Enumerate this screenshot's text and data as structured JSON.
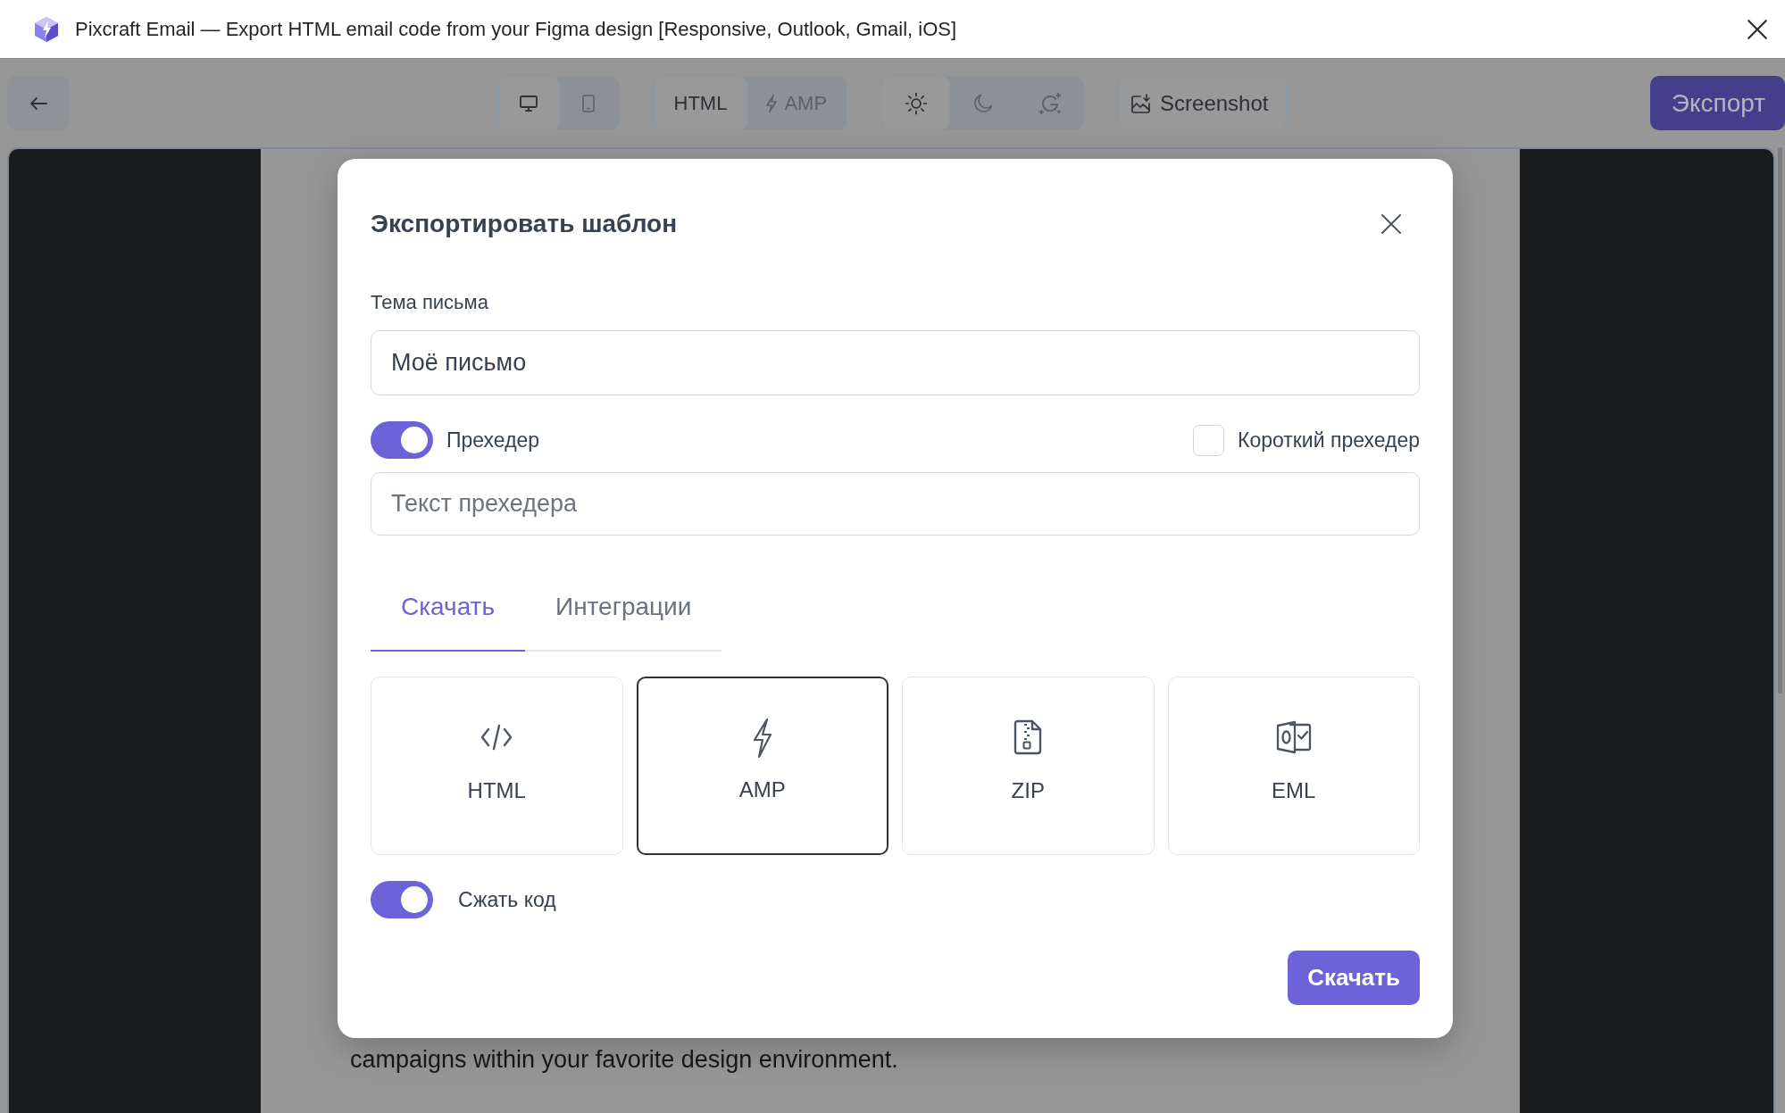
{
  "window": {
    "title": "Pixcraft Email — Export HTML email code from your Figma design [Responsive, Outlook, Gmail, iOS]"
  },
  "toolbar": {
    "device_toggle": [
      {
        "kind": "desktop",
        "selected": true
      },
      {
        "kind": "tablet",
        "selected": false
      }
    ],
    "format_toggle": [
      {
        "label": "HTML",
        "kind": "text",
        "selected": true
      },
      {
        "label": "AMP",
        "kind": "bolt",
        "selected": false
      }
    ],
    "theme_toggle": [
      {
        "kind": "light",
        "selected": true
      },
      {
        "kind": "dark",
        "selected": false
      },
      {
        "kind": "auto",
        "selected": false
      }
    ],
    "screenshot_button": {
      "label": "Screenshot"
    },
    "export_button": {
      "label": "Экспорт"
    }
  },
  "preview": {
    "text": "campaigns within your favorite design environment."
  },
  "dialog": {
    "title": "Экспортировать шаблон",
    "subject": {
      "label": "Тема письма",
      "value": "Моё письмо"
    },
    "preheader": {
      "label": "Прехедер",
      "on": true
    },
    "short_preheader": {
      "label": "Короткий прехедер",
      "checked": false
    },
    "preheader_field": {
      "placeholder": "Текст прехедера"
    },
    "tabs": [
      {
        "label": "Скачать",
        "selected": true
      },
      {
        "label": "Интеграции",
        "selected": false
      }
    ],
    "formats": [
      {
        "label": "HTML",
        "kind": "code",
        "selected": false
      },
      {
        "label": "AMP",
        "kind": "bolt",
        "selected": true
      },
      {
        "label": "ZIP",
        "kind": "zip",
        "selected": false
      },
      {
        "label": "EML",
        "kind": "outlook",
        "selected": false
      }
    ],
    "minify": {
      "label": "Сжать код",
      "on": true
    },
    "download_button": {
      "label": "Скачать"
    }
  }
}
